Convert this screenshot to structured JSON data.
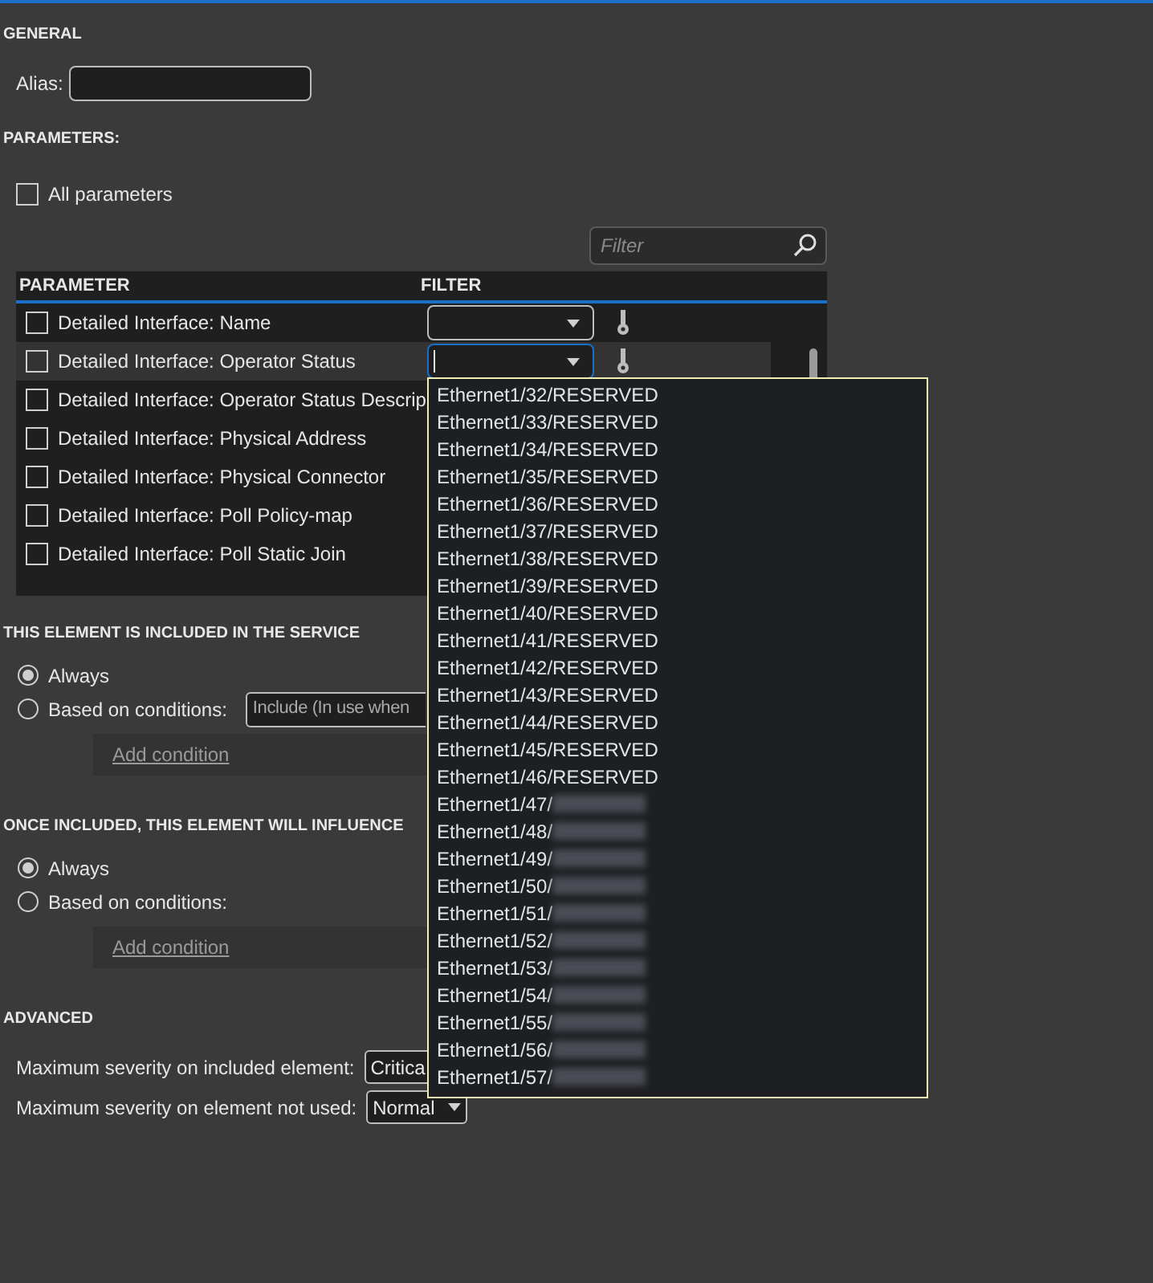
{
  "general": {
    "heading": "GENERAL",
    "alias": {
      "label": "Alias:"
    }
  },
  "parameters": {
    "heading": "PARAMETERS:",
    "all_parameters": {
      "label": "All parameters",
      "checked": false
    },
    "filter": {
      "placeholder": "Filter"
    },
    "columns": [
      "PARAMETER",
      "FILTER"
    ],
    "rows": [
      {
        "label": "Detailed Interface: Name",
        "checked": false,
        "selected": false,
        "has_filter": true
      },
      {
        "label": "Detailed Interface: Operator Status",
        "checked": false,
        "selected": true,
        "has_filter": true
      },
      {
        "label": "Detailed Interface: Operator Status Descrip",
        "checked": false,
        "selected": false
      },
      {
        "label": "Detailed Interface: Physical Address",
        "checked": false,
        "selected": false
      },
      {
        "label": "Detailed Interface: Physical Connector",
        "checked": false,
        "selected": false
      },
      {
        "label": "Detailed Interface: Poll Policy-map",
        "checked": false,
        "selected": false
      },
      {
        "label": "Detailed Interface: Poll Static Join",
        "checked": false,
        "selected": false
      }
    ]
  },
  "dropdown": {
    "items": [
      {
        "text": "Ethernet1/32/RESERVED",
        "redacted": false
      },
      {
        "text": "Ethernet1/33/RESERVED",
        "redacted": false
      },
      {
        "text": "Ethernet1/34/RESERVED",
        "redacted": false
      },
      {
        "text": "Ethernet1/35/RESERVED",
        "redacted": false
      },
      {
        "text": "Ethernet1/36/RESERVED",
        "redacted": false
      },
      {
        "text": "Ethernet1/37/RESERVED",
        "redacted": false
      },
      {
        "text": "Ethernet1/38/RESERVED",
        "redacted": false
      },
      {
        "text": "Ethernet1/39/RESERVED",
        "redacted": false
      },
      {
        "text": "Ethernet1/40/RESERVED",
        "redacted": false
      },
      {
        "text": "Ethernet1/41/RESERVED",
        "redacted": false
      },
      {
        "text": "Ethernet1/42/RESERVED",
        "redacted": false
      },
      {
        "text": "Ethernet1/43/RESERVED",
        "redacted": false
      },
      {
        "text": "Ethernet1/44/RESERVED",
        "redacted": false
      },
      {
        "text": "Ethernet1/45/RESERVED",
        "redacted": false
      },
      {
        "text": "Ethernet1/46/RESERVED",
        "redacted": false
      },
      {
        "text": "Ethernet1/47/",
        "redacted": true
      },
      {
        "text": "Ethernet1/48/",
        "redacted": true
      },
      {
        "text": "Ethernet1/49/",
        "redacted": true
      },
      {
        "text": "Ethernet1/50/",
        "redacted": true
      },
      {
        "text": "Ethernet1/51/",
        "redacted": true
      },
      {
        "text": "Ethernet1/52/",
        "redacted": true
      },
      {
        "text": "Ethernet1/53/",
        "redacted": true
      },
      {
        "text": "Ethernet1/54/",
        "redacted": true
      },
      {
        "text": "Ethernet1/55/",
        "redacted": true
      },
      {
        "text": "Ethernet1/56/",
        "redacted": true
      },
      {
        "text": "Ethernet1/57/",
        "redacted": true
      }
    ]
  },
  "inclusion": {
    "heading": "THIS ELEMENT IS INCLUDED IN THE SERVICE",
    "options": [
      {
        "label": "Always",
        "selected": true
      },
      {
        "label": "Based on conditions:",
        "selected": false
      }
    ],
    "condition_field": {
      "value": "Include (In use when"
    },
    "add_condition": "Add condition"
  },
  "influence": {
    "heading": "ONCE INCLUDED, THIS ELEMENT WILL INFLUENCE",
    "options": [
      {
        "label": "Always",
        "selected": true
      },
      {
        "label": "Based on conditions:",
        "selected": false
      }
    ],
    "add_condition": "Add condition"
  },
  "advanced": {
    "heading": "ADVANCED",
    "fields": [
      {
        "label": "Maximum severity on included element:",
        "value": "Critica"
      },
      {
        "label": "Maximum severity on element not used:",
        "value": "Normal"
      }
    ]
  }
}
